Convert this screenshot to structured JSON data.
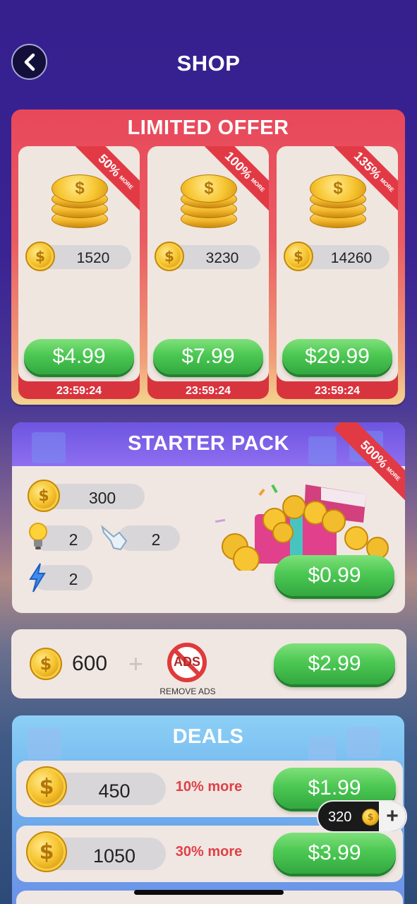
{
  "header": {
    "title": "SHOP",
    "back_icon": "chevron-left-icon"
  },
  "limited_offer": {
    "title": "LIMITED OFFER",
    "offers": [
      {
        "bonus": "50%",
        "bonus_label": "MORE",
        "coins": "1520",
        "price": "$4.99",
        "timer": "23:59:24"
      },
      {
        "bonus": "100%",
        "bonus_label": "MORE",
        "coins": "3230",
        "price": "$7.99",
        "timer": "23:59:24"
      },
      {
        "bonus": "135%",
        "bonus_label": "MORE",
        "coins": "14260",
        "price": "$29.99",
        "timer": "23:59:24"
      }
    ]
  },
  "starter_pack": {
    "title": "STARTER PACK",
    "coins": "300",
    "hints": "2",
    "taps": "2",
    "boosts": "2",
    "bonus": "500%",
    "bonus_label": "MORE",
    "price": "$0.99"
  },
  "remove_ads": {
    "coins": "600",
    "plus": "+",
    "ads_badge": "ADS",
    "label": "REMOVE ADS",
    "price": "$2.99"
  },
  "deals": {
    "title": "DEALS",
    "items": [
      {
        "coins": "450",
        "more": "10% more",
        "price": "$1.99"
      },
      {
        "coins": "1050",
        "more": "30% more",
        "price": "$3.99"
      }
    ]
  },
  "balance": {
    "coins": "320",
    "plus": "+"
  },
  "colors": {
    "background": "#35208e",
    "limited_red": "#e8485b",
    "green_button": "#4cc853",
    "starter_purple": "#7a5fe8",
    "deals_blue": "#6fb2ee",
    "more_red": "#e04048"
  }
}
